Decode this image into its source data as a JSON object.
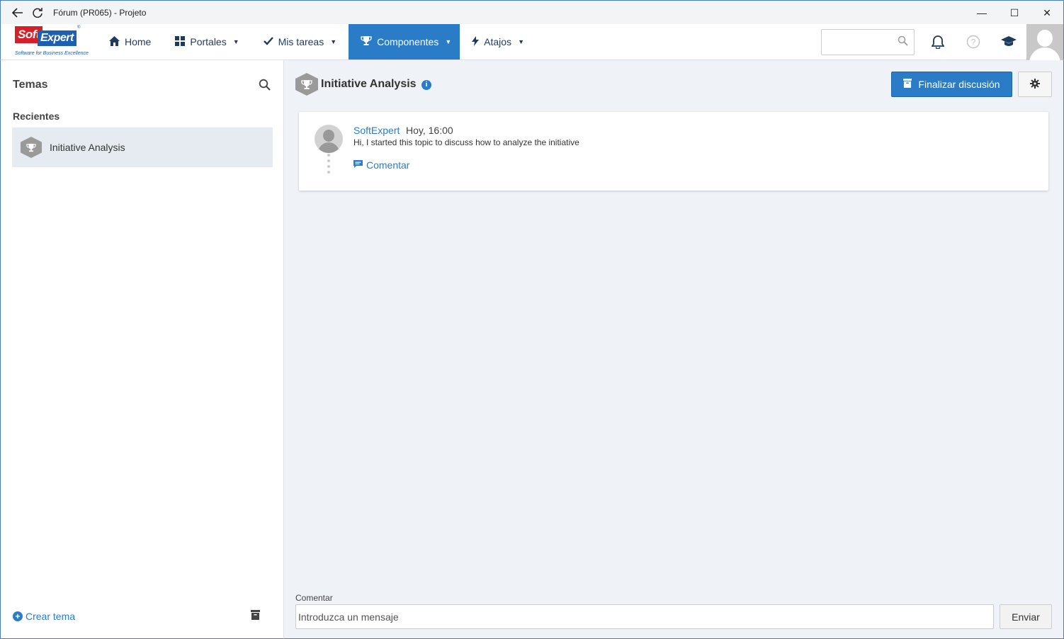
{
  "window": {
    "title": "Fórum (PR065) - Projeto",
    "back_icon": "arrow-left-icon",
    "refresh_icon": "refresh-icon",
    "controls": {
      "minimize": "—",
      "maximize": "☐",
      "close": "✕"
    }
  },
  "logo": {
    "soft": "Soft",
    "expert": "Expert",
    "tagline": "Software for Business Excellence",
    "reg": "®"
  },
  "nav": {
    "items": [
      {
        "label": "Home",
        "icon": "home-icon",
        "glyph": "⌂",
        "has_caret": false,
        "active": false
      },
      {
        "label": "Portales",
        "icon": "grid-icon",
        "glyph": "▦",
        "has_caret": true,
        "active": false
      },
      {
        "label": "Mis tareas",
        "icon": "check-icon",
        "glyph": "✓",
        "has_caret": true,
        "active": false
      },
      {
        "label": "Componentes",
        "icon": "trophy-icon",
        "glyph": "🏆",
        "has_caret": true,
        "active": true
      },
      {
        "label": "Atajos",
        "icon": "bolt-icon",
        "glyph": "⚡",
        "has_caret": true,
        "active": false
      }
    ],
    "caret": "▼",
    "search_placeholder": "",
    "accent_color": "#2a7cc7"
  },
  "sidebar": {
    "heading": "Temas",
    "recent_label": "Recientes",
    "items": [
      {
        "label": "Initiative Analysis",
        "icon": "trophy-icon"
      }
    ],
    "create_label": "Crear tema"
  },
  "topic": {
    "title": "Initiative Analysis",
    "info": "i",
    "finalize_label": "Finalizar discusión",
    "settings_icon": "gear-icon"
  },
  "post": {
    "author": "SoftExpert",
    "time": "Hoy, 16:00",
    "message": "Hi, I started this topic to discuss how to analyze the initiative",
    "comment_label": "Comentar"
  },
  "composer": {
    "label": "Comentar",
    "placeholder": "Introduzca un mensaje",
    "send_label": "Enviar"
  }
}
